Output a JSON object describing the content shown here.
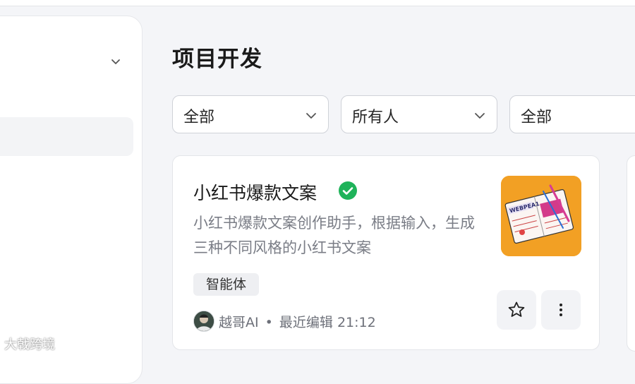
{
  "page": {
    "title": "项目开发"
  },
  "filters": [
    {
      "label": "全部"
    },
    {
      "label": "所有人"
    },
    {
      "label": "全部"
    }
  ],
  "card": {
    "title": "小红书爆款文案",
    "verified": true,
    "description": "小红书爆款文案创作助手，根据输入，生成三种不同风格的小红书文案",
    "tag": "智能体",
    "author": "越哥AI",
    "separator": "•",
    "edited": "最近编辑 21:12",
    "thumbnail_text": "WEBPEA1"
  },
  "icons": {
    "sidebar_toggle": "chevron-down-icon",
    "filter": "chevron-down-icon",
    "verified": "check-circle-icon",
    "favorite": "star-icon",
    "more": "more-vertical-icon"
  },
  "watermark": "大戟跨境",
  "colors": {
    "verified": "#1fb35a",
    "thumbnail_bg": "#f2a024"
  }
}
